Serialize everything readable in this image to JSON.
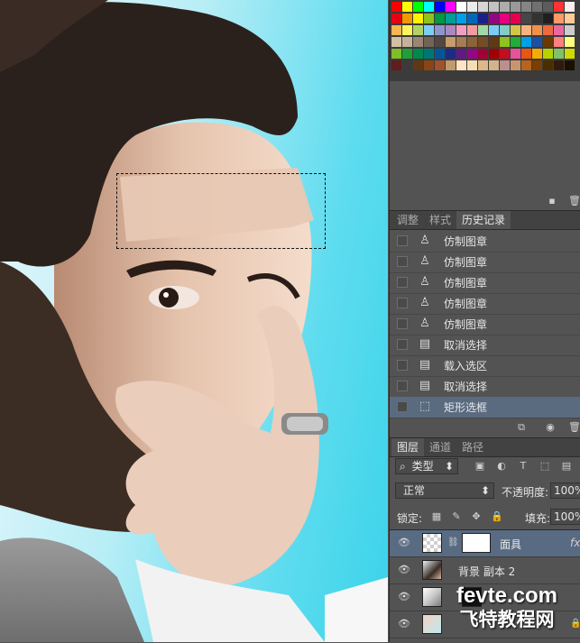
{
  "swatch_colors": [
    [
      "#ff0000",
      "#ffff00",
      "#00ff00",
      "#00ffff",
      "#0000ff",
      "#ff00ff",
      "#ffffff",
      "#ebebeb",
      "#d6d6d6",
      "#c2c2c2",
      "#adadad",
      "#999999",
      "#858585",
      "#707070",
      "#5c5c5c",
      "#ff3333",
      "#ffeeee"
    ],
    [
      "#e60012",
      "#f39800",
      "#fff100",
      "#8fc31f",
      "#009944",
      "#009e96",
      "#00a0e9",
      "#0068b7",
      "#1d2088",
      "#920783",
      "#e4007f",
      "#e5004f",
      "#474747",
      "#333333",
      "#1f1f1f",
      "#ff9966",
      "#ffcc99"
    ],
    [
      "#f8b551",
      "#fff45c",
      "#b3d465",
      "#7ecef4",
      "#8c97cb",
      "#aa89bd",
      "#f19ec2",
      "#f29c9f",
      "#a4d7a8",
      "#7ccdf4",
      "#84ccc9",
      "#d7c447",
      "#f6b37f",
      "#f19149",
      "#ec6941",
      "#ea68a2",
      "#cccccc"
    ],
    [
      "#d1c0a5",
      "#c7b299",
      "#998675",
      "#736357",
      "#534741",
      "#c69c6d",
      "#a67c52",
      "#8c6239",
      "#754c24",
      "#603913",
      "#8dc21f",
      "#22ac38",
      "#00a0e9",
      "#1e50a2",
      "#6a3906",
      "#ff8080",
      "#ffff80"
    ],
    [
      "#7fbe26",
      "#1fa038",
      "#00884d",
      "#007575",
      "#00569d",
      "#1d2a88",
      "#601986",
      "#920783",
      "#a40035",
      "#a40000",
      "#c30d23",
      "#e85298",
      "#e95513",
      "#f7ab00",
      "#b8d200",
      "#80c269",
      "#cfdb00"
    ],
    [
      "#5f1d1d",
      "#3e3a39",
      "#603813",
      "#8b4513",
      "#a0522d",
      "#c19a6b",
      "#ffe4c4",
      "#f5deb3",
      "#deb887",
      "#d2b48c",
      "#bc8f8f",
      "#c7956c",
      "#b5651d",
      "#7b3f00",
      "#4b2e00",
      "#2f1b0c",
      "#1a0f00"
    ]
  ],
  "tabs_top": [
    {
      "label": "调整",
      "active": false
    },
    {
      "label": "样式",
      "active": false
    },
    {
      "label": "历史记录",
      "active": true
    }
  ],
  "history": [
    {
      "label": "仿制图章",
      "icon": "stamp-icon",
      "selected": false
    },
    {
      "label": "仿制图章",
      "icon": "stamp-icon",
      "selected": false
    },
    {
      "label": "仿制图章",
      "icon": "stamp-icon",
      "selected": false
    },
    {
      "label": "仿制图章",
      "icon": "stamp-icon",
      "selected": false
    },
    {
      "label": "仿制图章",
      "icon": "stamp-icon",
      "selected": false
    },
    {
      "label": "取消选择",
      "icon": "document-icon",
      "selected": false
    },
    {
      "label": "载入选区",
      "icon": "document-icon",
      "selected": false
    },
    {
      "label": "取消选择",
      "icon": "document-icon",
      "selected": false
    },
    {
      "label": "矩形选框",
      "icon": "rect-marquee-icon",
      "selected": true
    }
  ],
  "tabs_layers": [
    {
      "label": "图层",
      "active": true
    },
    {
      "label": "通道",
      "active": false
    },
    {
      "label": "路径",
      "active": false
    }
  ],
  "layers_panel": {
    "search_icon": "⌕",
    "kind_label": "类型",
    "blend_mode": "正常",
    "opacity_label": "不透明度:",
    "opacity_value": "100%",
    "lock_label": "锁定:",
    "fill_label": "填充:",
    "fill_value": "100%",
    "filter_glyphs": [
      "▣",
      "◐",
      "T",
      "⬚",
      "▤"
    ],
    "lock_glyphs": [
      "▦",
      "✎",
      "✥",
      "🔒"
    ],
    "fx_label": "fx"
  },
  "layers": [
    {
      "name": "面具",
      "selected": true,
      "visible": true
    },
    {
      "name": "背景 副本 2",
      "selected": false,
      "visible": true
    },
    {
      "name": "",
      "selected": false,
      "visible": true
    },
    {
      "name": "",
      "selected": false,
      "visible": true
    }
  ],
  "watermark": {
    "line1": "fevte.com",
    "line2": "飞特教程网"
  },
  "selection_glyph": "⬚",
  "eye_glyph": "👁"
}
